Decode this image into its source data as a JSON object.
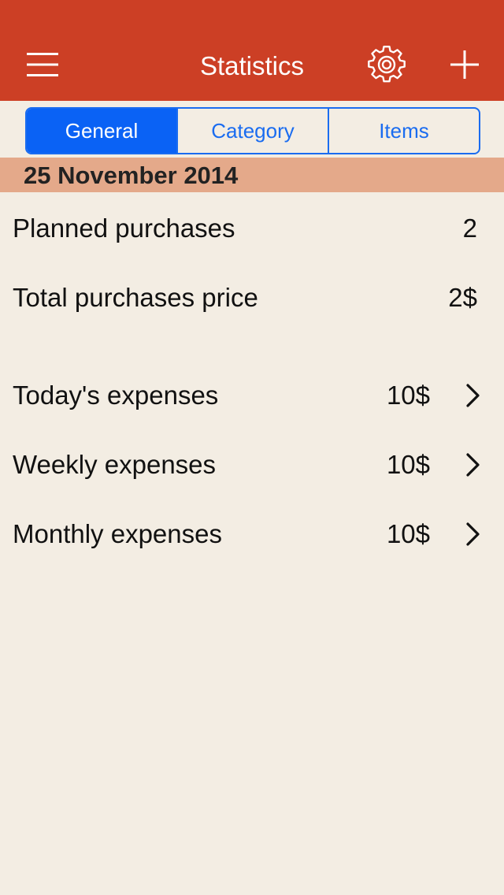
{
  "header": {
    "title": "Statistics",
    "menu_icon": "hamburger-menu-icon",
    "settings_icon": "gear-icon",
    "add_icon": "plus-icon"
  },
  "tabs": [
    {
      "label": "General",
      "active": true
    },
    {
      "label": "Category",
      "active": false
    },
    {
      "label": "Items",
      "active": false
    }
  ],
  "date_header": "25 November 2014",
  "stats": {
    "planned_purchases": {
      "label": "Planned purchases",
      "value": "2"
    },
    "total_price": {
      "label": "Total purchases price",
      "value": "2$"
    }
  },
  "expenses": [
    {
      "label": "Today's expenses",
      "value": "10$"
    },
    {
      "label": "Weekly expenses",
      "value": "10$"
    },
    {
      "label": "Monthly expenses",
      "value": "10$"
    }
  ],
  "colors": {
    "navbar": "#cc3f25",
    "accent_blue": "#0a62f5",
    "date_header_bg": "#e4a98a",
    "background": "#f3ede3"
  }
}
